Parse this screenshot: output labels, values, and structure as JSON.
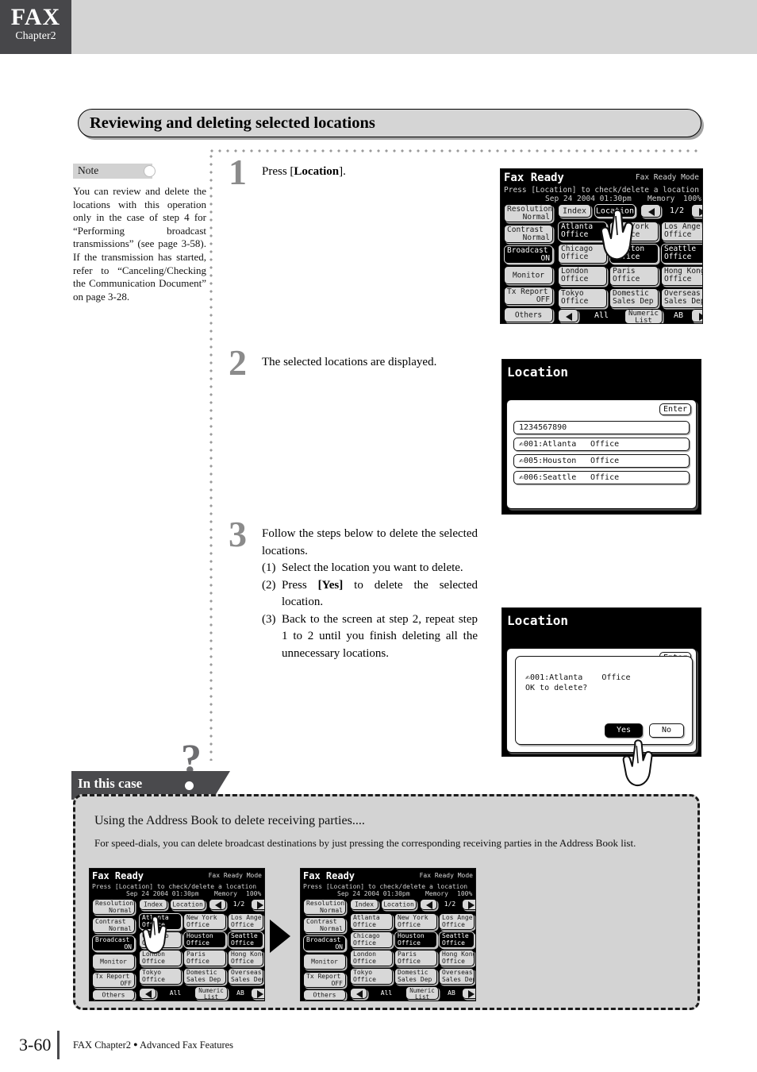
{
  "header": {
    "chapter_tag": "FAX",
    "chapter_label": "Chapter2"
  },
  "section_title": "Reviewing and deleting selected locations",
  "note": {
    "label": "Note",
    "body": "You can review and delete the locations with this operation only in the case of step 4 for “Performing broadcast transmissions” (see page 3-58). If the transmission has started, refer to “Canceling/Checking the Communication Document” on page 3-28."
  },
  "steps": [
    {
      "number": "1",
      "text_plain": "Press [Location].",
      "text_prefix": "Press [",
      "text_bold": "Location",
      "text_suffix": "]."
    },
    {
      "number": "2",
      "text_plain": "The selected locations are displayed."
    },
    {
      "number": "3",
      "lead": "Follow the steps below to delete the selected locations.",
      "sub1_n": "(1)",
      "sub1_t": "Select the location you want to delete.",
      "sub2_n": "(2)",
      "sub2_a": "Press ",
      "sub2_b": "[Yes]",
      "sub2_c": " to delete the selected location.",
      "sub3_n": "(3)",
      "sub3_t": "Back to the screen at step 2, repeat step 1 to 2 until you finish deleting all the unnecessary locations."
    }
  ],
  "fax_screen_1": {
    "title": "Fax Ready",
    "mode": "Fax Ready Mode",
    "prompt": "Press [Location] to check/delete a location",
    "datetime": "Sep 24 2004 01:30pm",
    "memory_label": "Memory",
    "memory_value": "100%",
    "side_keys": [
      {
        "l1": "Resolution",
        "l2": "Normal",
        "selected": false
      },
      {
        "l1": "Contrast",
        "l2": "Normal",
        "selected": false
      },
      {
        "l1": "Broadcast",
        "l2": "ON",
        "selected": true
      },
      {
        "l1": "Monitor",
        "l2": "",
        "selected": false
      },
      {
        "l1": "Tx Report",
        "l2": "OFF",
        "selected": false
      },
      {
        "l1": "Others",
        "l2": "",
        "selected": false
      }
    ],
    "top_bar": {
      "index": "Index",
      "location": "Location",
      "prev_icon": "triangle-left-icon",
      "page": "1/2",
      "next_icon": "triangle-right-icon"
    },
    "locations": [
      {
        "l1": "Atlanta",
        "l2": "Office",
        "selected": true
      },
      {
        "l1": "New York",
        "l2": "Office",
        "selected": false
      },
      {
        "l1": "Los Angels",
        "l2": "Office",
        "selected": false
      },
      {
        "l1": "Chicago",
        "l2": "Office",
        "selected": false
      },
      {
        "l1": "Houston",
        "l2": "Office",
        "selected": true
      },
      {
        "l1": "Seattle",
        "l2": "Office",
        "selected": true
      },
      {
        "l1": "London",
        "l2": "Office",
        "selected": false
      },
      {
        "l1": "Paris",
        "l2": "Office",
        "selected": false
      },
      {
        "l1": "Hong Kong",
        "l2": "Office",
        "selected": false
      },
      {
        "l1": "Tokyo",
        "l2": "Office",
        "selected": false
      },
      {
        "l1": "Domestic",
        "l2": "Sales Dep",
        "selected": false
      },
      {
        "l1": "Overseas",
        "l2": "Sales Dep",
        "selected": false
      }
    ],
    "bottom_bar": {
      "prev_icon": "triangle-left-icon",
      "all": "All",
      "numeric_l1": "Numeric",
      "numeric_l2": "List",
      "ab": "AB",
      "next_icon": "triangle-right-icon"
    }
  },
  "fax_screen_2": {
    "title": "Location",
    "enter": "Enter",
    "number_row": "1234567890",
    "rows": [
      {
        "id": "001:Atlanta",
        "office": "Office"
      },
      {
        "id": "005:Houston",
        "office": "Office"
      },
      {
        "id": "006:Seattle",
        "office": "Office"
      }
    ]
  },
  "fax_screen_3": {
    "title": "Location",
    "enter": "Enter",
    "dialog_line1": "001:Atlanta    Office",
    "dialog_line2": "OK to delete?",
    "yes": "Yes",
    "no": "No"
  },
  "in_this_case": {
    "tab_label": "In this case",
    "heading": "Using the Address Book to delete receiving parties....",
    "body": "For speed-dials, you can delete broadcast destinations by just pressing the corresponding receiving parties in the Address Book list."
  },
  "mini_screen_a": {
    "title": "Fax Ready",
    "mode": "Fax Ready Mode",
    "prompt": "Press [Location] to check/delete a location",
    "datetime": "Sep 24 2004 01:30pm",
    "memory_label": "Memory",
    "memory_value": "100%",
    "side_keys": [
      {
        "l1": "Resolution",
        "l2": "Normal",
        "selected": false
      },
      {
        "l1": "Contrast",
        "l2": "Normal",
        "selected": false
      },
      {
        "l1": "Broadcast",
        "l2": "ON",
        "selected": true
      },
      {
        "l1": "Monitor",
        "l2": "",
        "selected": false
      },
      {
        "l1": "Tx Report",
        "l2": "OFF",
        "selected": false
      },
      {
        "l1": "Others",
        "l2": "",
        "selected": false
      }
    ],
    "top_bar": {
      "index": "Index",
      "location": "Location",
      "page": "1/2"
    },
    "locations": [
      {
        "l1": "Atlanta",
        "l2": "Office",
        "selected": true
      },
      {
        "l1": "New York",
        "l2": "Office",
        "selected": false
      },
      {
        "l1": "Los Angels",
        "l2": "Office",
        "selected": false
      },
      {
        "l1": "Chicago",
        "l2": "Office",
        "selected": false
      },
      {
        "l1": "Houston",
        "l2": "Office",
        "selected": true
      },
      {
        "l1": "Seattle",
        "l2": "Office",
        "selected": true
      },
      {
        "l1": "London",
        "l2": "Office",
        "selected": false
      },
      {
        "l1": "Paris",
        "l2": "Office",
        "selected": false
      },
      {
        "l1": "Hong Kong",
        "l2": "Office",
        "selected": false
      },
      {
        "l1": "Tokyo",
        "l2": "Office",
        "selected": false
      },
      {
        "l1": "Domestic",
        "l2": "Sales Dep",
        "selected": false
      },
      {
        "l1": "Overseas",
        "l2": "Sales Dep",
        "selected": false
      }
    ],
    "bottom_bar": {
      "all": "All",
      "numeric_l1": "Numeric",
      "numeric_l2": "List",
      "ab": "AB"
    }
  },
  "mini_screen_b": {
    "title": "Fax Ready",
    "mode": "Fax Ready Mode",
    "prompt": "Press [Location] to check/delete a location",
    "datetime": "Sep 24 2004 01:30pm",
    "memory_label": "Memory",
    "memory_value": "100%",
    "side_keys": [
      {
        "l1": "Resolution",
        "l2": "Normal",
        "selected": false
      },
      {
        "l1": "Contrast",
        "l2": "Normal",
        "selected": false
      },
      {
        "l1": "Broadcast",
        "l2": "ON",
        "selected": true
      },
      {
        "l1": "Monitor",
        "l2": "",
        "selected": false
      },
      {
        "l1": "Tx Report",
        "l2": "OFF",
        "selected": false
      },
      {
        "l1": "Others",
        "l2": "",
        "selected": false
      }
    ],
    "top_bar": {
      "index": "Index",
      "location": "Location",
      "page": "1/2"
    },
    "locations": [
      {
        "l1": "Atlanta",
        "l2": "Office",
        "selected": false
      },
      {
        "l1": "New York",
        "l2": "Office",
        "selected": false
      },
      {
        "l1": "Los Angels",
        "l2": "Office",
        "selected": false
      },
      {
        "l1": "Chicago",
        "l2": "Office",
        "selected": false
      },
      {
        "l1": "Houston",
        "l2": "Office",
        "selected": true
      },
      {
        "l1": "Seattle",
        "l2": "Office",
        "selected": true
      },
      {
        "l1": "London",
        "l2": "Office",
        "selected": false
      },
      {
        "l1": "Paris",
        "l2": "Office",
        "selected": false
      },
      {
        "l1": "Hong Kong",
        "l2": "Office",
        "selected": false
      },
      {
        "l1": "Tokyo",
        "l2": "Office",
        "selected": false
      },
      {
        "l1": "Domestic",
        "l2": "Sales Dep",
        "selected": false
      },
      {
        "l1": "Overseas",
        "l2": "Sales Dep",
        "selected": false
      }
    ],
    "bottom_bar": {
      "all": "All",
      "numeric_l1": "Numeric",
      "numeric_l2": "List",
      "ab": "AB"
    }
  },
  "footer": {
    "page_number": "3-60",
    "caption_a": "FAX Chapter2",
    "bullet": "●",
    "caption_b": "Advanced Fax Features"
  }
}
